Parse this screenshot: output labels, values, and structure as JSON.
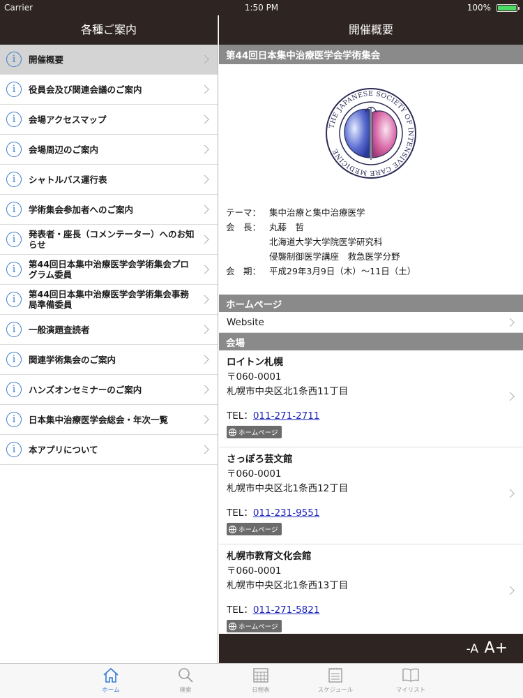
{
  "status_bar": {
    "carrier": "Carrier",
    "time": "1:50 PM",
    "battery": "100%"
  },
  "left": {
    "title": "各種ご案内",
    "items": [
      {
        "label": "開催概要",
        "selected": true
      },
      {
        "label": "役員会及び関連会議のご案内"
      },
      {
        "label": "会場アクセスマップ"
      },
      {
        "label": "会場周辺のご案内"
      },
      {
        "label": "シャトルバス運行表"
      },
      {
        "label": "学術集会参加者へのご案内"
      },
      {
        "label": "発表者・座長（コメンテーター）へのお知らせ"
      },
      {
        "label": "第44回日本集中治療医学会学術集会プログラム委員"
      },
      {
        "label": "第44回日本集中治療医学会学術集会事務局準備委員"
      },
      {
        "label": "一般演題査読者"
      },
      {
        "label": "関連学術集会のご案内"
      },
      {
        "label": "ハンズオンセミナーのご案内"
      },
      {
        "label": "日本集中治療医学会総会・年次一覧"
      },
      {
        "label": "本アプリについて"
      }
    ]
  },
  "right": {
    "title": "開催概要",
    "conference_title": "第44回日本集中治療医学会学術集会",
    "logo_text": "THE JAPANESE SOCIETY OF INTENSIVE CARE MEDICINE",
    "info": {
      "theme_key": "テーマ：",
      "theme_val": "集中治療と集中治療医学",
      "president_key": "会　長：",
      "president_name": "丸藤　哲",
      "president_aff1": "北海道大学大学院医学研究科",
      "president_aff2": "侵襲制御医学講座　救急医学分野",
      "period_key": "会　期：",
      "period_val": "平成29年3月9日（木）〜11日（土）"
    },
    "homepage_head": "ホームページ",
    "website_label": "Website",
    "venue_head": "会場",
    "venues": [
      {
        "name": "ロイトン札幌",
        "zip": "〒060-0001",
        "address": "札幌市中央区北1条西11丁目",
        "tel_label": "TEL：",
        "tel": "011-271-2711",
        "hp": "ホームページ"
      },
      {
        "name": "さっぽろ芸文館",
        "zip": "〒060-0001",
        "address": "札幌市中央区北1条西12丁目",
        "tel_label": "TEL：",
        "tel": "011-231-9551",
        "hp": "ホームページ"
      },
      {
        "name": "札幌市教育文化会館",
        "zip": "〒060-0001",
        "address": "札幌市中央区北1条西13丁目",
        "tel_label": "TEL：",
        "tel": "011-271-5821",
        "hp": "ホームページ"
      }
    ],
    "font_minus": "-A",
    "font_plus": "A+"
  },
  "tabs": [
    {
      "label": "ホーム",
      "icon": "home-icon",
      "active": true
    },
    {
      "label": "検索",
      "icon": "search-icon"
    },
    {
      "label": "日程表",
      "icon": "calendar-icon"
    },
    {
      "label": "スケジュール",
      "icon": "schedule-icon"
    },
    {
      "label": "マイリスト",
      "icon": "book-icon"
    }
  ],
  "colors": {
    "nav_bg": "#2e2522",
    "section_bg": "#8a8a8a",
    "accent": "#3578d4",
    "link": "#1a23b8"
  }
}
